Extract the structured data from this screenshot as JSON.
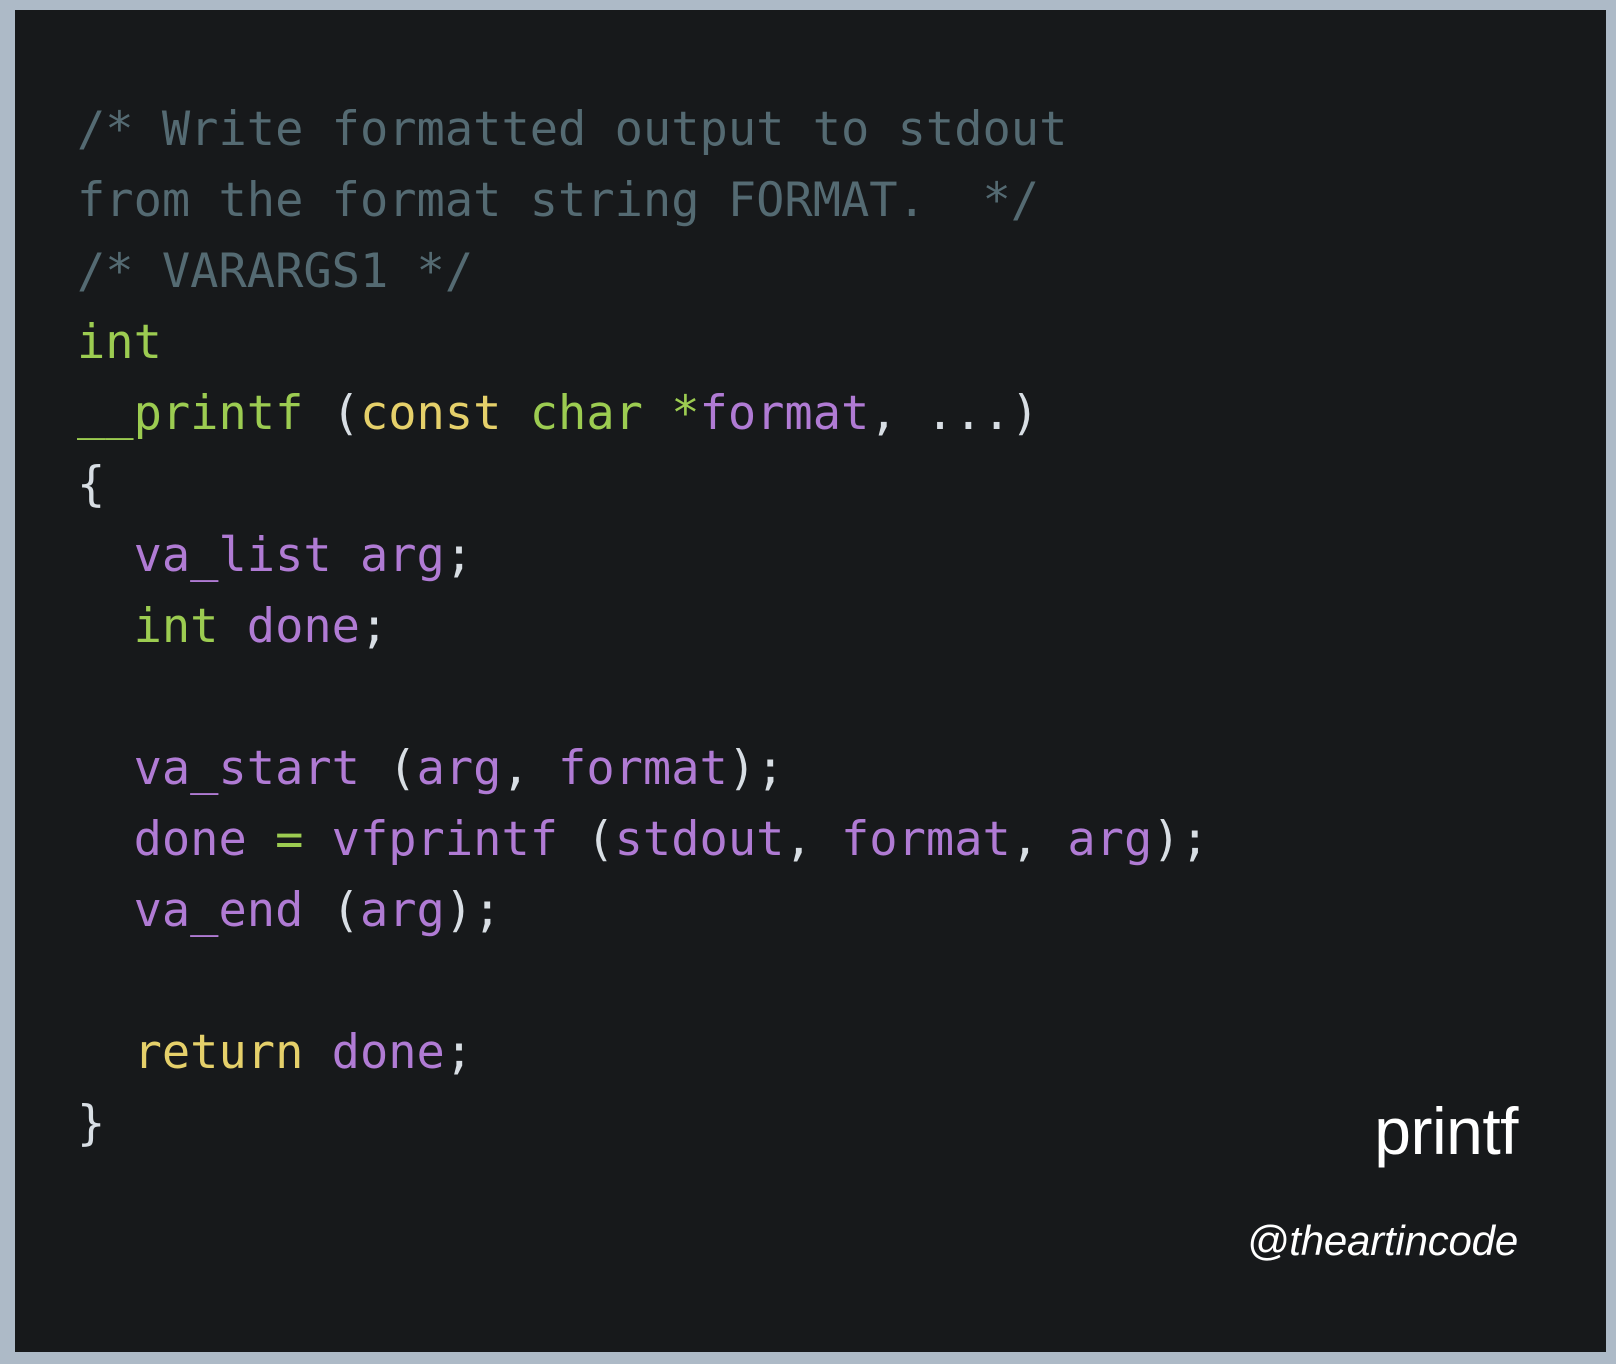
{
  "theme": {
    "frame_color": "#adbac7",
    "background": "#17191b",
    "comment_color": "#546a72",
    "type_color": "#9ccc51",
    "keyword_color": "#e5d06a",
    "identifier_color": "#b07bd4",
    "punctuation_color": "#d8dee4",
    "operator_color": "#9ccc51",
    "brand_color": "#ffffff"
  },
  "code": {
    "language": "c",
    "lines": [
      {
        "tokens": [
          {
            "t": "/* Write formatted output to stdout",
            "c": "comment"
          }
        ]
      },
      {
        "tokens": [
          {
            "t": "from the format string FORMAT.  */",
            "c": "comment"
          }
        ]
      },
      {
        "tokens": [
          {
            "t": "/* VARARGS1 */",
            "c": "comment"
          }
        ]
      },
      {
        "tokens": [
          {
            "t": "int",
            "c": "type"
          }
        ]
      },
      {
        "tokens": [
          {
            "t": "__printf",
            "c": "func"
          },
          {
            "t": " ",
            "c": "punct"
          },
          {
            "t": "(",
            "c": "punct"
          },
          {
            "t": "const",
            "c": "keyword"
          },
          {
            "t": " ",
            "c": "punct"
          },
          {
            "t": "char",
            "c": "type"
          },
          {
            "t": " ",
            "c": "punct"
          },
          {
            "t": "*",
            "c": "op"
          },
          {
            "t": "format",
            "c": "ident"
          },
          {
            "t": ", ...)",
            "c": "punct"
          }
        ]
      },
      {
        "tokens": [
          {
            "t": "{",
            "c": "punct"
          }
        ]
      },
      {
        "tokens": [
          {
            "t": "  ",
            "c": "punct"
          },
          {
            "t": "va_list",
            "c": "ident"
          },
          {
            "t": " ",
            "c": "punct"
          },
          {
            "t": "arg",
            "c": "ident"
          },
          {
            "t": ";",
            "c": "punct"
          }
        ]
      },
      {
        "tokens": [
          {
            "t": "  ",
            "c": "punct"
          },
          {
            "t": "int",
            "c": "type"
          },
          {
            "t": " ",
            "c": "punct"
          },
          {
            "t": "done",
            "c": "ident"
          },
          {
            "t": ";",
            "c": "punct"
          }
        ]
      },
      {
        "tokens": [
          {
            "t": "",
            "c": "punct"
          }
        ]
      },
      {
        "tokens": [
          {
            "t": "  ",
            "c": "punct"
          },
          {
            "t": "va_start",
            "c": "ident"
          },
          {
            "t": " (",
            "c": "punct"
          },
          {
            "t": "arg",
            "c": "ident"
          },
          {
            "t": ", ",
            "c": "punct"
          },
          {
            "t": "format",
            "c": "ident"
          },
          {
            "t": ");",
            "c": "punct"
          }
        ]
      },
      {
        "tokens": [
          {
            "t": "  ",
            "c": "punct"
          },
          {
            "t": "done",
            "c": "ident"
          },
          {
            "t": " ",
            "c": "punct"
          },
          {
            "t": "=",
            "c": "op"
          },
          {
            "t": " ",
            "c": "punct"
          },
          {
            "t": "vfprintf",
            "c": "ident"
          },
          {
            "t": " (",
            "c": "punct"
          },
          {
            "t": "stdout",
            "c": "ident"
          },
          {
            "t": ", ",
            "c": "punct"
          },
          {
            "t": "format",
            "c": "ident"
          },
          {
            "t": ", ",
            "c": "punct"
          },
          {
            "t": "arg",
            "c": "ident"
          },
          {
            "t": ");",
            "c": "punct"
          }
        ]
      },
      {
        "tokens": [
          {
            "t": "  ",
            "c": "punct"
          },
          {
            "t": "va_end",
            "c": "ident"
          },
          {
            "t": " (",
            "c": "punct"
          },
          {
            "t": "arg",
            "c": "ident"
          },
          {
            "t": ");",
            "c": "punct"
          }
        ]
      },
      {
        "tokens": [
          {
            "t": "",
            "c": "punct"
          }
        ]
      },
      {
        "tokens": [
          {
            "t": "  ",
            "c": "punct"
          },
          {
            "t": "return",
            "c": "keyword"
          },
          {
            "t": " ",
            "c": "punct"
          },
          {
            "t": "done",
            "c": "ident"
          },
          {
            "t": ";",
            "c": "punct"
          }
        ]
      },
      {
        "tokens": [
          {
            "t": "}",
            "c": "punct"
          }
        ]
      }
    ]
  },
  "brand": {
    "title": "printf",
    "handle": "@theartincode"
  }
}
